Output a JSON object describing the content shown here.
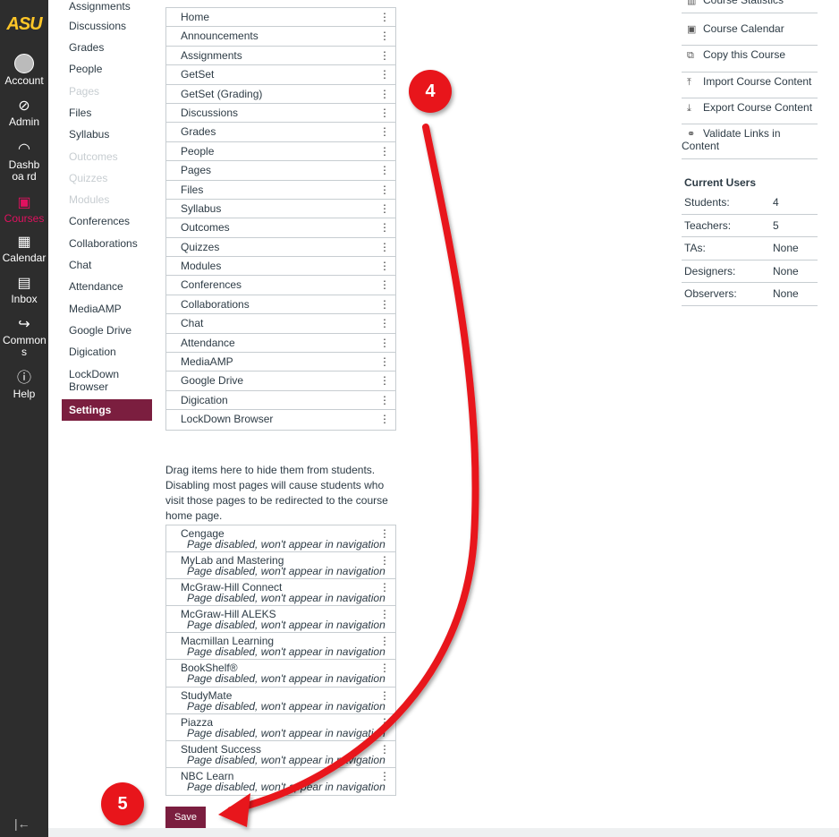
{
  "global_nav": {
    "logo": "ASU",
    "items": [
      {
        "label": "Account",
        "icon": "account-avatar"
      },
      {
        "label": "Admin",
        "icon": "admin-shield-icon"
      },
      {
        "label": "Dashboa rd",
        "icon": "dashboard-gauge-icon"
      },
      {
        "label": "Courses",
        "icon": "courses-book-icon"
      },
      {
        "label": "Calendar",
        "icon": "calendar-icon"
      },
      {
        "label": "Inbox",
        "icon": "inbox-icon"
      },
      {
        "label": "Common s",
        "icon": "commons-icon"
      },
      {
        "label": "Help",
        "icon": "help-icon"
      }
    ],
    "collapse_glyph": "|←"
  },
  "course_nav": [
    {
      "label": "Assignments",
      "state": "enabled"
    },
    {
      "label": "Discussions",
      "state": "enabled"
    },
    {
      "label": "Grades",
      "state": "enabled"
    },
    {
      "label": "People",
      "state": "enabled"
    },
    {
      "label": "Pages",
      "state": "disabled"
    },
    {
      "label": "Files",
      "state": "enabled"
    },
    {
      "label": "Syllabus",
      "state": "enabled"
    },
    {
      "label": "Outcomes",
      "state": "disabled"
    },
    {
      "label": "Quizzes",
      "state": "disabled"
    },
    {
      "label": "Modules",
      "state": "disabled"
    },
    {
      "label": "Conferences",
      "state": "enabled"
    },
    {
      "label": "Collaborations",
      "state": "enabled"
    },
    {
      "label": "Chat",
      "state": "enabled"
    },
    {
      "label": "Attendance",
      "state": "enabled"
    },
    {
      "label": "MediaAMP",
      "state": "enabled"
    },
    {
      "label": "Google Drive",
      "state": "enabled"
    },
    {
      "label": "Digication",
      "state": "enabled"
    },
    {
      "label": "LockDown Browser",
      "state": "enabled"
    },
    {
      "label": "Settings",
      "state": "active"
    }
  ],
  "enabled_items": [
    "Home",
    "Announcements",
    "Assignments",
    "GetSet",
    "GetSet (Grading)",
    "Discussions",
    "Grades",
    "People",
    "Pages",
    "Files",
    "Syllabus",
    "Outcomes",
    "Quizzes",
    "Modules",
    "Conferences",
    "Collaborations",
    "Chat",
    "Attendance",
    "MediaAMP",
    "Google Drive",
    "Digication",
    "LockDown Browser"
  ],
  "kebab_glyph": "⋮",
  "hint_text": "Drag items here to hide them from students. Disabling most pages will cause students who visit those pages to be redirected to the course home page.",
  "disabled_note": "Page disabled, won't appear in navigation",
  "disabled_items": [
    "Cengage",
    "MyLab and Mastering",
    "McGraw-Hill Connect",
    "McGraw-Hill ALEKS",
    "Macmillan Learning",
    "BookShelf®",
    "StudyMate",
    "Piazza",
    "Student Success",
    "NBC Learn"
  ],
  "save_label": "Save",
  "sidebar_links": [
    {
      "label": "Course Statistics",
      "icon": "statistics-icon"
    },
    {
      "label": "Course Calendar",
      "icon": "calendar-icon"
    },
    {
      "label": "Copy this Course",
      "icon": "copy-icon"
    },
    {
      "label": "Import Course Content",
      "icon": "import-icon"
    },
    {
      "label": "Export Course Content",
      "icon": "export-icon"
    },
    {
      "label": "Validate Links in Content",
      "icon": "link-icon"
    }
  ],
  "current_users": {
    "heading": "Current Users",
    "rows": [
      {
        "label": "Students:",
        "value": "4"
      },
      {
        "label": "Teachers:",
        "value": "5"
      },
      {
        "label": "TAs:",
        "value": "None"
      },
      {
        "label": "Designers:",
        "value": "None"
      },
      {
        "label": "Observers:",
        "value": "None"
      }
    ]
  },
  "annotations": {
    "step_a": "4",
    "step_b": "5",
    "arrow_color": "#e8151b"
  },
  "colors": {
    "brand": "#7b1e3f",
    "nav_bg": "#2d2d2d",
    "logo": "#ffc627"
  }
}
